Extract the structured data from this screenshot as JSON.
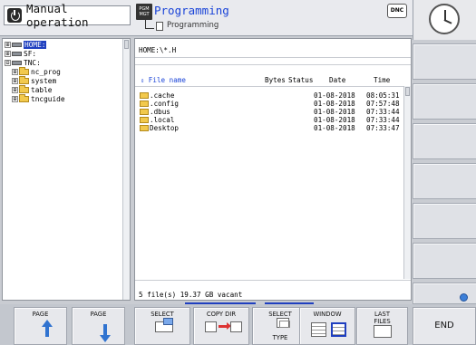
{
  "header": {
    "mode_label": "Manual operation",
    "program_icon_text": "PGM MGT",
    "program_title": "Programming",
    "program_subtitle": "Programming",
    "dnc_label": "DNC"
  },
  "tree": {
    "items": [
      {
        "expander": "⊞",
        "icon": "drive",
        "label": "HOME:",
        "selected": true
      },
      {
        "expander": "⊞",
        "icon": "drive",
        "label": "SF:",
        "selected": false
      },
      {
        "expander": "⊟",
        "icon": "drive",
        "label": "TNC:",
        "selected": false
      },
      {
        "expander": "⊞",
        "icon": "folder",
        "label": "nc_prog",
        "selected": false
      },
      {
        "expander": "⊞",
        "icon": "folder",
        "label": "system",
        "selected": false
      },
      {
        "expander": "⊞",
        "icon": "folder",
        "label": "table",
        "selected": false
      },
      {
        "expander": "⊞",
        "icon": "folder",
        "label": "tncguide",
        "selected": false
      }
    ]
  },
  "files": {
    "path": "HOME:\\*.H",
    "columns": {
      "name": "File name",
      "bytes": "Bytes",
      "status": "Status",
      "date": "Date",
      "time": "Time"
    },
    "rows": [
      {
        "name": ".cache",
        "date": "01-08-2018",
        "time": "08:05:31"
      },
      {
        "name": ".config",
        "date": "01-08-2018",
        "time": "07:57:48"
      },
      {
        "name": ".dbus",
        "date": "01-08-2018",
        "time": "07:33:44"
      },
      {
        "name": ".local",
        "date": "01-08-2018",
        "time": "07:33:44"
      },
      {
        "name": "Desktop",
        "date": "01-08-2018",
        "time": "07:33:47"
      }
    ],
    "status": "5    file(s)  19.37 GB vacant"
  },
  "softkeys": {
    "page_up": "PAGE",
    "page_down": "PAGE",
    "select": "SELECT",
    "copy_dir": "COPY DIR",
    "select_type_1": "SELECT",
    "select_type_2": "TYPE",
    "window": "WINDOW",
    "last_files_1": "LAST",
    "last_files_2": "FILES",
    "end": "END"
  },
  "colors": {
    "accent_blue": "#1a44d8",
    "selection": "#1f3fbf",
    "folder": "#f2c94c"
  }
}
